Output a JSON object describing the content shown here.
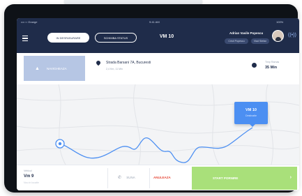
{
  "status_bar": {
    "carrier": "•••○○ Orange",
    "time": "9:41 AM",
    "battery": "100%"
  },
  "header": {
    "tabs": [
      {
        "label": "IN DESFASURARE"
      },
      {
        "label": "SCHIMBA STATUS"
      }
    ],
    "title": "VM 10",
    "user_name": "Adrian Vasile Popescu",
    "chips": [
      "Cristi Popescu",
      "Vlad Stefan"
    ]
  },
  "info": {
    "navigate_label": "NAVIGHEAZA",
    "address": "Strada Barsani 7A, Bucuresti",
    "address_sub": "2,4 Km, 11 Min",
    "time_label": "Timp Ramas",
    "time_value": "35 Min"
  },
  "map": {
    "marker_title": "VM 10",
    "marker_sub": "Destinatie",
    "route_color": "#4c8ff2"
  },
  "bottom": {
    "label": "Vehicul",
    "value": "Vm 9",
    "sub": "Nou in locatie",
    "call_label": "SUNA",
    "cancel_label": "ANULEAZA",
    "start_label": "START PORNIRE"
  }
}
